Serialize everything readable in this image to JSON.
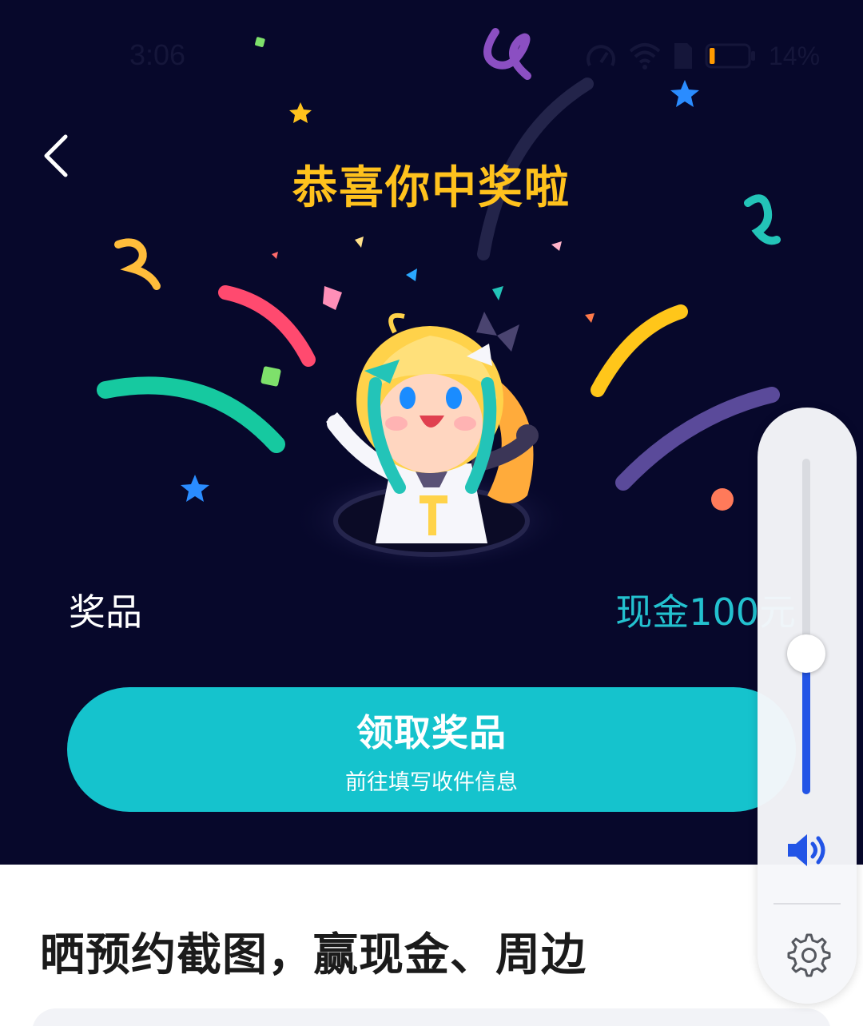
{
  "status_bar": {
    "time": "3:06",
    "battery_percent": "14%",
    "battery_level": 0.14,
    "icons": [
      "speed-icon",
      "wifi-icon",
      "sim-icon",
      "battery-icon"
    ]
  },
  "header": {
    "back_icon": "chevron-left-icon",
    "title": "恭喜你中奖啦"
  },
  "prize": {
    "label": "奖品",
    "value": "现金100元"
  },
  "claim_button": {
    "label": "领取奖品",
    "sublabel": "前往填写收件信息"
  },
  "promo": {
    "title": "晒预约截图，赢现金、周边"
  },
  "volume_panel": {
    "level": 0.42,
    "speaker_icon": "speaker-icon",
    "settings_icon": "gear-icon"
  },
  "colors": {
    "background": "#07082b",
    "title": "#ffc21d",
    "accent": "#15c3cd",
    "prize_value": "#23c1cf",
    "volume_fill": "#2254e6"
  }
}
